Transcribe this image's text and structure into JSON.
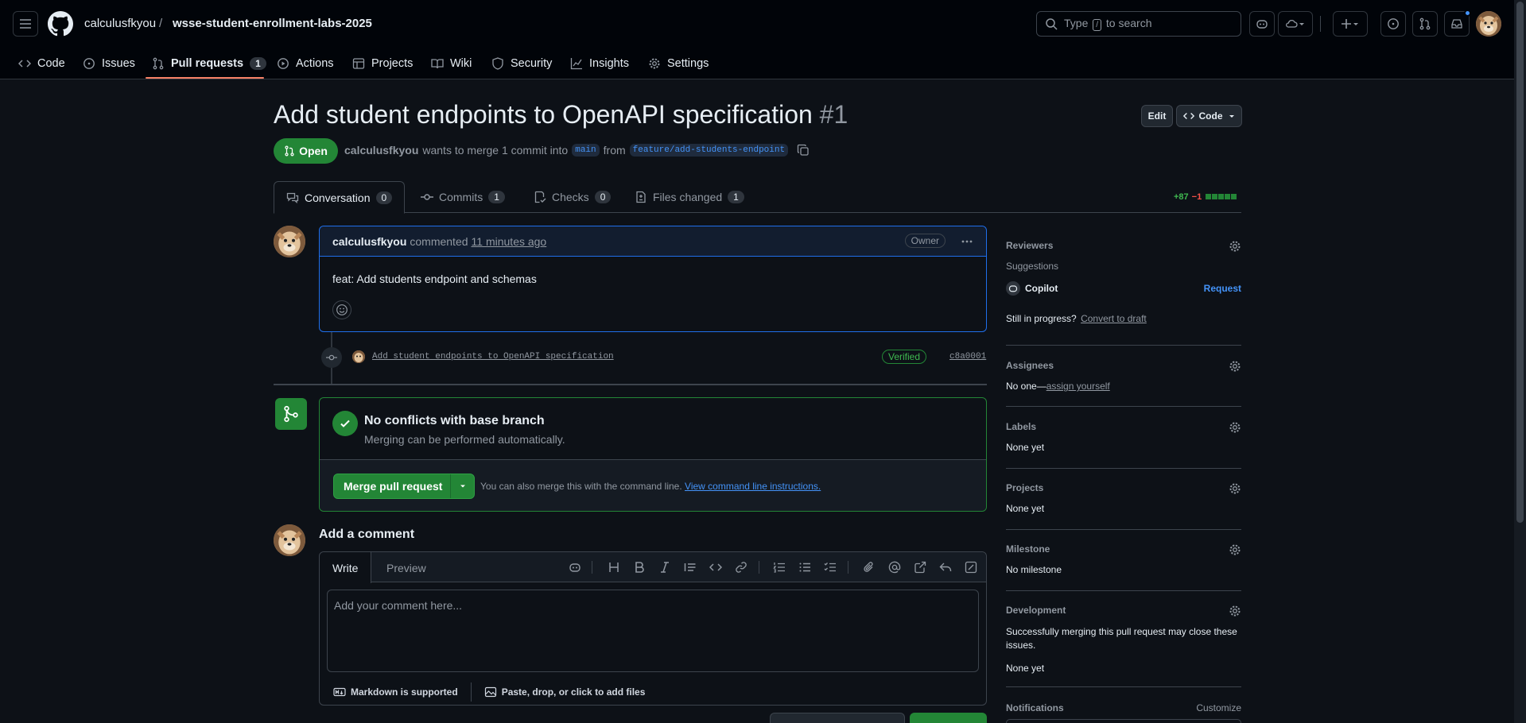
{
  "header": {
    "owner": "calculusfkyou",
    "separator": "/",
    "repo": "wsse-student-enrollment-labs-2025",
    "search_pre": "Type",
    "search_key": "/",
    "search_post": "to search"
  },
  "repo_tabs": [
    {
      "label": "Code",
      "icon": "code-icon"
    },
    {
      "label": "Issues",
      "icon": "issue-icon"
    },
    {
      "label": "Pull requests",
      "icon": "pull-request-icon",
      "count": "1"
    },
    {
      "label": "Actions",
      "icon": "play-icon"
    },
    {
      "label": "Projects",
      "icon": "table-icon"
    },
    {
      "label": "Wiki",
      "icon": "book-icon"
    },
    {
      "label": "Security",
      "icon": "shield-icon"
    },
    {
      "label": "Insights",
      "icon": "graph-icon"
    },
    {
      "label": "Settings",
      "icon": "gear-icon"
    }
  ],
  "pr": {
    "title": "Add student endpoints to OpenAPI specification",
    "number": "#1",
    "edit_label": "Edit",
    "code_label": "Code",
    "state": "Open",
    "author": "calculusfkyou",
    "meta_text": "wants to merge 1 commit into",
    "base": "main",
    "from": "from",
    "head": "feature/add-students-endpoint"
  },
  "pr_tabs": [
    {
      "label": "Conversation",
      "count": "0"
    },
    {
      "label": "Commits",
      "count": "1"
    },
    {
      "label": "Checks",
      "count": "0"
    },
    {
      "label": "Files changed",
      "count": "1"
    }
  ],
  "diffstat": {
    "added": "+87",
    "removed": "−1"
  },
  "comment": {
    "author": "calculusfkyou",
    "action": "commented",
    "time": "11 minutes ago",
    "badge": "Owner",
    "body": "feat: Add students endpoint and schemas"
  },
  "commit": {
    "message": "Add student endpoints to OpenAPI specification",
    "verified": "Verified",
    "sha": "c8a0001"
  },
  "merge": {
    "title": "No conflicts with base branch",
    "subtitle": "Merging can be performed automatically.",
    "button": "Merge pull request",
    "hint": "You can also merge this with the command line.",
    "link": "View command line instructions."
  },
  "add_comment": {
    "heading": "Add a comment",
    "write": "Write",
    "preview": "Preview",
    "placeholder": "Add your comment here...",
    "markdown": "Markdown is supported",
    "attach": "Paste, drop, or click to add files"
  },
  "sidebar": {
    "reviewers": "Reviewers",
    "suggestions": "Suggestions",
    "copilot": "Copilot",
    "request": "Request",
    "in_progress": "Still in progress?",
    "convert": "Convert to draft",
    "assignees": "Assignees",
    "no_one": "No one—",
    "assign_self": "assign yourself",
    "labels": "Labels",
    "labels_value": "None yet",
    "projects": "Projects",
    "projects_value": "None yet",
    "milestone": "Milestone",
    "milestone_value": "No milestone",
    "development": "Development",
    "dev_text": "Successfully merging this pull request may close these issues.",
    "dev_value": "None yet",
    "notifications": "Notifications",
    "customize": "Customize"
  },
  "colors": {
    "accent": "#4493f8",
    "success": "#238636",
    "danger": "#f85149",
    "bg": "#0d1117"
  }
}
